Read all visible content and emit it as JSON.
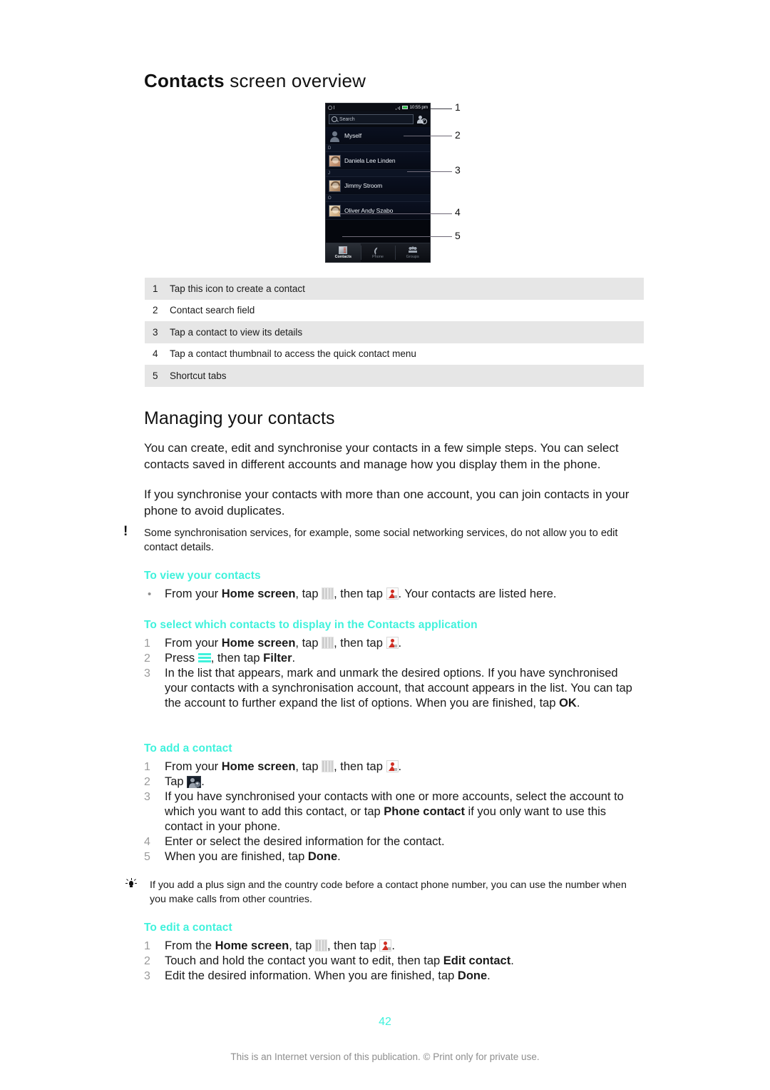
{
  "page": {
    "title_bold": "Contacts",
    "title_rest": " screen overview",
    "number": "42",
    "footer": "This is an Internet version of this publication. © Print only for private use."
  },
  "figure": {
    "status_bar": {
      "time": "10:55 pm"
    },
    "search": {
      "placeholder": "Search"
    },
    "add_contact_icon": "add-contact-icon",
    "self_row": {
      "name": "Myself"
    },
    "sections": [
      {
        "letter": "D",
        "contacts": [
          {
            "name": "Daniela Lee Linden"
          }
        ]
      },
      {
        "letter": "J",
        "contacts": [
          {
            "name": "Jimmy Stroom"
          }
        ]
      },
      {
        "letter": "O",
        "contacts": [
          {
            "name": "Oliver Andy Szabo"
          }
        ]
      }
    ],
    "tabs": [
      {
        "label": "Contacts",
        "icon": "contacts-icon",
        "active": true
      },
      {
        "label": "Phone",
        "icon": "phone-icon",
        "active": false
      },
      {
        "label": "Groups",
        "icon": "groups-icon",
        "active": false
      }
    ],
    "callouts": [
      "1",
      "2",
      "3",
      "4",
      "5"
    ]
  },
  "legend": {
    "rows": [
      {
        "n": "1",
        "text": "Tap this icon to create a contact"
      },
      {
        "n": "2",
        "text": "Contact search field"
      },
      {
        "n": "3",
        "text": "Tap a contact to view its details"
      },
      {
        "n": "4",
        "text": "Tap a contact thumbnail to access the quick contact menu"
      },
      {
        "n": "5",
        "text": "Shortcut tabs"
      }
    ]
  },
  "managing": {
    "heading": "Managing your contacts",
    "para1": "You can create, edit and synchronise your contacts in a few simple steps. You can select contacts saved in different accounts and manage how you display them in the phone.",
    "para2": "If you synchronise your contacts with more than one account, you can join contacts in your phone to avoid duplicates.",
    "note": "Some synchronisation services, for example, some social networking services, do not allow you to edit contact details.",
    "note_icon": "!"
  },
  "view_contacts": {
    "heading": "To view your contacts",
    "bullet": {
      "marker": "•",
      "part1": "From your ",
      "bold1": "Home screen",
      "part2": ", tap ",
      "icon1": "app-drawer-grid-icon",
      "part3": ", then tap ",
      "icon2": "contacts-app-icon",
      "part4": ". Your contacts are listed here."
    }
  },
  "select_contacts": {
    "heading": "To select which contacts to display in the Contacts application",
    "step1": {
      "n": "1",
      "part1": "From your ",
      "bold1": "Home screen",
      "part2": ", tap ",
      "icon1": "app-drawer-grid-icon",
      "part3": ", then tap ",
      "icon2": "contacts-app-icon",
      "part4": "."
    },
    "step2": {
      "n": "2",
      "part1": "Press ",
      "icon1": "menu-icon",
      "part2": ", then tap ",
      "bold1": "Filter",
      "part3": "."
    },
    "step3": {
      "n": "3",
      "part1": "In the list that appears, mark and unmark the desired options. If you have synchronised your contacts with a synchronisation account, that account appears in the list. You can tap the account to further expand the list of options. When you are finished, tap ",
      "bold1": "OK",
      "part2": "."
    }
  },
  "add_contact": {
    "heading": "To add a contact",
    "step1": {
      "n": "1",
      "part1": "From your ",
      "bold1": "Home screen",
      "part2": ", tap ",
      "icon1": "app-drawer-grid-icon",
      "part3": ", then tap ",
      "icon2": "contacts-app-icon",
      "part4": "."
    },
    "step2": {
      "n": "2",
      "part1": "Tap ",
      "icon1": "add-contact-icon",
      "part2": "."
    },
    "step3": {
      "n": "3",
      "part1": "If you have synchronised your contacts with one or more accounts, select the account to which you want to add this contact, or tap ",
      "bold1": "Phone contact",
      "part2": " if you only want to use this contact in your phone."
    },
    "step4": {
      "n": "4",
      "text": "Enter or select the desired information for the contact."
    },
    "step5": {
      "n": "5",
      "part1": "When you are finished, tap ",
      "bold1": "Done",
      "part2": "."
    }
  },
  "tip": {
    "icon": "lightbulb-icon",
    "text": "If you add a plus sign and the country code before a contact phone number, you can use the number when you make calls from other countries."
  },
  "edit_contact": {
    "heading": "To edit a contact",
    "step1": {
      "n": "1",
      "part1": "From the ",
      "bold1": "Home screen",
      "part2": ", tap ",
      "icon1": "app-drawer-grid-icon",
      "part3": ", then tap ",
      "icon2": "contacts-app-icon",
      "part4": "."
    },
    "step2": {
      "n": "2",
      "part1": "Touch and hold the contact you want to edit, then tap ",
      "bold1": "Edit contact",
      "part2": "."
    },
    "step3": {
      "n": "3",
      "part1": "Edit the desired information. When you are finished, tap ",
      "bold1": "Done",
      "part2": "."
    }
  },
  "colors": {
    "accent_cyan": "#3ff2dc",
    "legend_alt_row": "#e6e6e6",
    "footer_gray": "#8d8d8d",
    "contacts_icon_red": "#cf2f24"
  }
}
